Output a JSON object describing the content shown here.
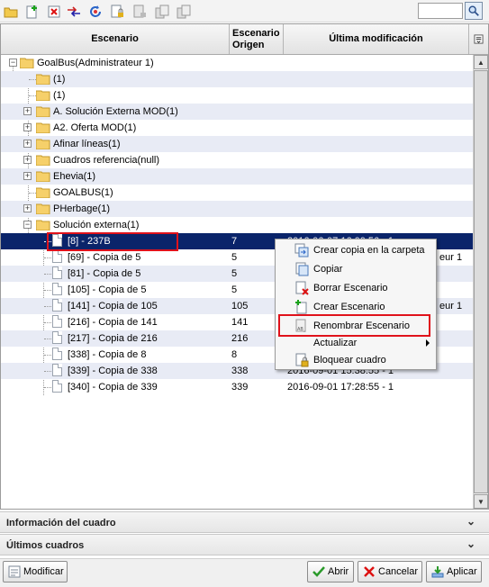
{
  "toolbar": {
    "buttons": [
      "open-folder-icon",
      "new-icon",
      "delete-icon",
      "move-icon",
      "refresh-icon",
      "lock-icon",
      "unlock-icon",
      "copy-icon",
      "paste-icon"
    ],
    "search_placeholder": ""
  },
  "grid": {
    "columns": {
      "scenario": "Escenario",
      "origin": "Escenario\nOrigen",
      "modified": "Última modificación"
    },
    "rows": [
      {
        "name": "GoalBus(Administrateur 1)",
        "orig": "",
        "mod": ""
      },
      {
        "name": "(1)",
        "orig": "",
        "mod": ""
      },
      {
        "name": "(1)",
        "orig": "",
        "mod": ""
      },
      {
        "name": "A. Solución Externa MOD(1)",
        "orig": "",
        "mod": ""
      },
      {
        "name": "A2. Oferta MOD(1)",
        "orig": "",
        "mod": ""
      },
      {
        "name": "Afinar líneas(1)",
        "orig": "",
        "mod": ""
      },
      {
        "name": "Cuadros referencia(null)",
        "orig": "",
        "mod": ""
      },
      {
        "name": "Ehevia(1)",
        "orig": "",
        "mod": ""
      },
      {
        "name": "GOALBUS(1)",
        "orig": "",
        "mod": ""
      },
      {
        "name": "PHerbage(1)",
        "orig": "",
        "mod": ""
      },
      {
        "name": "Solución externa(1)",
        "orig": "",
        "mod": ""
      },
      {
        "name": "[8] - 237B",
        "orig": "7",
        "mod": "2016-06-07 16:00:56 - 1"
      },
      {
        "name": "[69] - Copia de 5",
        "orig": "5",
        "mod": "eur 1"
      },
      {
        "name": "[81] - Copia de 5",
        "orig": "5",
        "mod": ""
      },
      {
        "name": "[105] - Copia de 5",
        "orig": "5",
        "mod": ""
      },
      {
        "name": "[141] - Copia de 105",
        "orig": "105",
        "mod": "eur 1"
      },
      {
        "name": "[216] - Copia de 141",
        "orig": "141",
        "mod": ""
      },
      {
        "name": "[217] - Copia de 216",
        "orig": "216",
        "mod": ""
      },
      {
        "name": "[338] - Copia de 8",
        "orig": "8",
        "mod": ""
      },
      {
        "name": "[339] - Copia de 338",
        "orig": "338",
        "mod": "2016-09-01 15:38:55 - 1"
      },
      {
        "name": "[340] - Copia de 339",
        "orig": "339",
        "mod": "2016-09-01 17:28:55 - 1"
      }
    ]
  },
  "context_menu": {
    "items": [
      {
        "label": "Crear copia en la carpeta",
        "icon": "copy-to-folder-icon"
      },
      {
        "label": "Copiar",
        "icon": "copy-icon"
      },
      {
        "label": "Borrar Escenario",
        "icon": "delete-scenario-icon"
      },
      {
        "label": "Crear Escenario",
        "icon": "create-scenario-icon"
      },
      {
        "label": "Renombrar Escenario",
        "icon": "rename-icon"
      },
      {
        "label": "Actualizar",
        "icon": ""
      },
      {
        "label": "Bloquear cuadro",
        "icon": "lock-icon"
      }
    ]
  },
  "panels": {
    "info": "Información del cuadro",
    "recent": "Últimos cuadros"
  },
  "buttons": {
    "modify": "Modificar",
    "open": "Abrir",
    "cancel": "Cancelar",
    "apply": "Aplicar"
  },
  "colors": {
    "selection": "#0a246a",
    "highlight_red": "#e0121b",
    "alt_row": "#e8ebf5"
  }
}
